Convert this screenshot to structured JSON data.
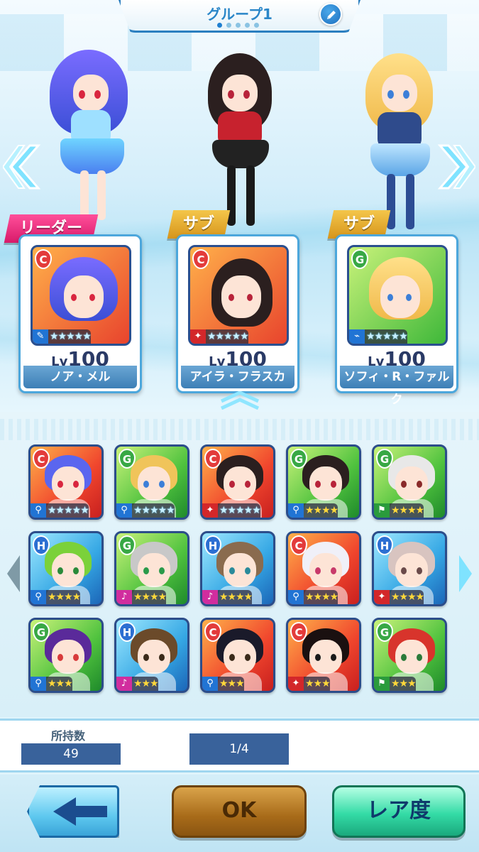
{
  "header": {
    "group_title": "グループ1",
    "page_dots": 5,
    "active_dot": 0,
    "edit_icon": "pencil-icon"
  },
  "team": {
    "leader_badge": "リーダー",
    "sub_badge": "サブ",
    "members": [
      {
        "rank": "C",
        "level_prefix": "Lv",
        "level": "100",
        "name": "ノア・メル",
        "stars": 5,
        "type_icon": "racket-icon",
        "type_color": "#2174d4"
      },
      {
        "rank": "C",
        "level_prefix": "Lv",
        "level": "100",
        "name": "アイラ・フラスカ",
        "stars": 5,
        "type_icon": "runner-icon",
        "type_color": "#d3272a"
      },
      {
        "rank": "G",
        "level_prefix": "Lv",
        "level": "100",
        "name": "ソフィ・R・ファルク",
        "stars": 5,
        "type_icon": "shoe-icon",
        "type_color": "#2174d4"
      }
    ]
  },
  "collection": {
    "icons": [
      {
        "rank": "C",
        "stars": "★★★★★",
        "type": "blue"
      },
      {
        "rank": "G",
        "stars": "★★★★★",
        "type": "blue"
      },
      {
        "rank": "C",
        "stars": "★★★★★",
        "type": "red"
      },
      {
        "rank": "G",
        "stars": "★★★★",
        "type": "blue"
      },
      {
        "rank": "G",
        "stars": "★★★★",
        "type": "green"
      },
      {
        "rank": "H",
        "stars": "★★★★",
        "type": "blue"
      },
      {
        "rank": "G",
        "stars": "★★★★",
        "type": "pink"
      },
      {
        "rank": "H",
        "stars": "★★★★",
        "type": "pink"
      },
      {
        "rank": "C",
        "stars": "★★★★",
        "type": "blue"
      },
      {
        "rank": "H",
        "stars": "★★★★",
        "type": "red"
      },
      {
        "rank": "G",
        "stars": "★★★",
        "type": "blue"
      },
      {
        "rank": "H",
        "stars": "★★★",
        "type": "pink"
      },
      {
        "rank": "C",
        "stars": "★★★",
        "type": "blue"
      },
      {
        "rank": "C",
        "stars": "★★★",
        "type": "red"
      },
      {
        "rank": "G",
        "stars": "★★★",
        "type": "green"
      }
    ]
  },
  "info": {
    "owned_label": "所持数",
    "owned_value": "49",
    "page_indicator": "1/4"
  },
  "buttons": {
    "back_icon": "arrow-left-icon",
    "ok_label": "OK",
    "rarity_label": "レア度"
  },
  "colors": {
    "accent_blue": "#2a86c8",
    "leader_pink": "#e0287a",
    "sub_gold": "#e0aa2a",
    "ok_brown": "#a86b19",
    "rarity_green": "#34dba6"
  }
}
